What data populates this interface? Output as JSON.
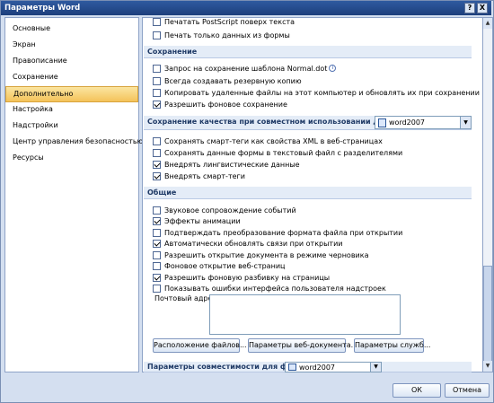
{
  "window": {
    "title": "Параметры Word",
    "help_glyph": "?",
    "close_glyph": "X"
  },
  "sidebar": {
    "items": [
      {
        "label": "Основные"
      },
      {
        "label": "Экран"
      },
      {
        "label": "Правописание"
      },
      {
        "label": "Сохранение"
      },
      {
        "label": "Дополнительно",
        "active": true
      },
      {
        "label": "Настройка"
      },
      {
        "label": "Надстройки"
      },
      {
        "label": "Центр управления безопасностью"
      },
      {
        "label": "Ресурсы"
      }
    ]
  },
  "print_options": [
    {
      "label": "Печатать PostScript поверх текста",
      "checked": false
    },
    {
      "label": "Печать только данных из формы",
      "checked": false
    }
  ],
  "save_section": {
    "title": "Сохранение",
    "options": [
      {
        "label": "Запрос на сохранение шаблона Normal.dot",
        "checked": false,
        "info_icon": "info-icon"
      },
      {
        "label": "Всегда создавать резервную копию",
        "checked": false
      },
      {
        "label": "Копировать удаленные файлы на этот компьютер и обновлять их при сохранении",
        "checked": false
      },
      {
        "label": "Разрешить фоновое сохранение",
        "checked": true
      }
    ]
  },
  "quality_section": {
    "title": "Сохранение качества при совместном использовании документа:",
    "document": "word2007",
    "options": [
      {
        "label": "Сохранять смарт-теги как свойства XML в веб-страницах",
        "checked": false
      },
      {
        "label": "Сохранять данные формы в текстовый файл с разделителями",
        "checked": false
      },
      {
        "label": "Внедрять лингвистические данные",
        "checked": true
      },
      {
        "label": "Внедрять смарт-теги",
        "checked": true
      }
    ]
  },
  "general_section": {
    "title": "Общие",
    "options": [
      {
        "label": "Звуковое сопровождение событий",
        "checked": false
      },
      {
        "label": "Эффекты анимации",
        "checked": true
      },
      {
        "label": "Подтверждать преобразование формата файла при открытии",
        "checked": false
      },
      {
        "label": "Автоматически обновлять связи при открытии",
        "checked": true
      },
      {
        "label": "Разрешить открытие документа в режиме черновика",
        "checked": false
      },
      {
        "label": "Фоновое открытие веб-страниц",
        "checked": false
      },
      {
        "label": "Разрешить фоновую разбивку на страницы",
        "checked": true
      },
      {
        "label": "Показывать ошибки интерфейса пользователя надстроек",
        "checked": false
      }
    ],
    "mail_address_label": "Почтовый адрес:",
    "mail_address_value": "",
    "buttons": {
      "file_locations": "Расположение файлов...",
      "web_options": "Параметры веб-документа...",
      "service_options": "Параметры служб..."
    }
  },
  "compat_section": {
    "title": "Параметры совместимости для файла:",
    "document": "word2007"
  },
  "footer": {
    "ok": "ОК",
    "cancel": "Отмена"
  },
  "scrollbar": {
    "up_glyph": "▲",
    "down_glyph": "▼",
    "combo_glyph": "▼"
  }
}
